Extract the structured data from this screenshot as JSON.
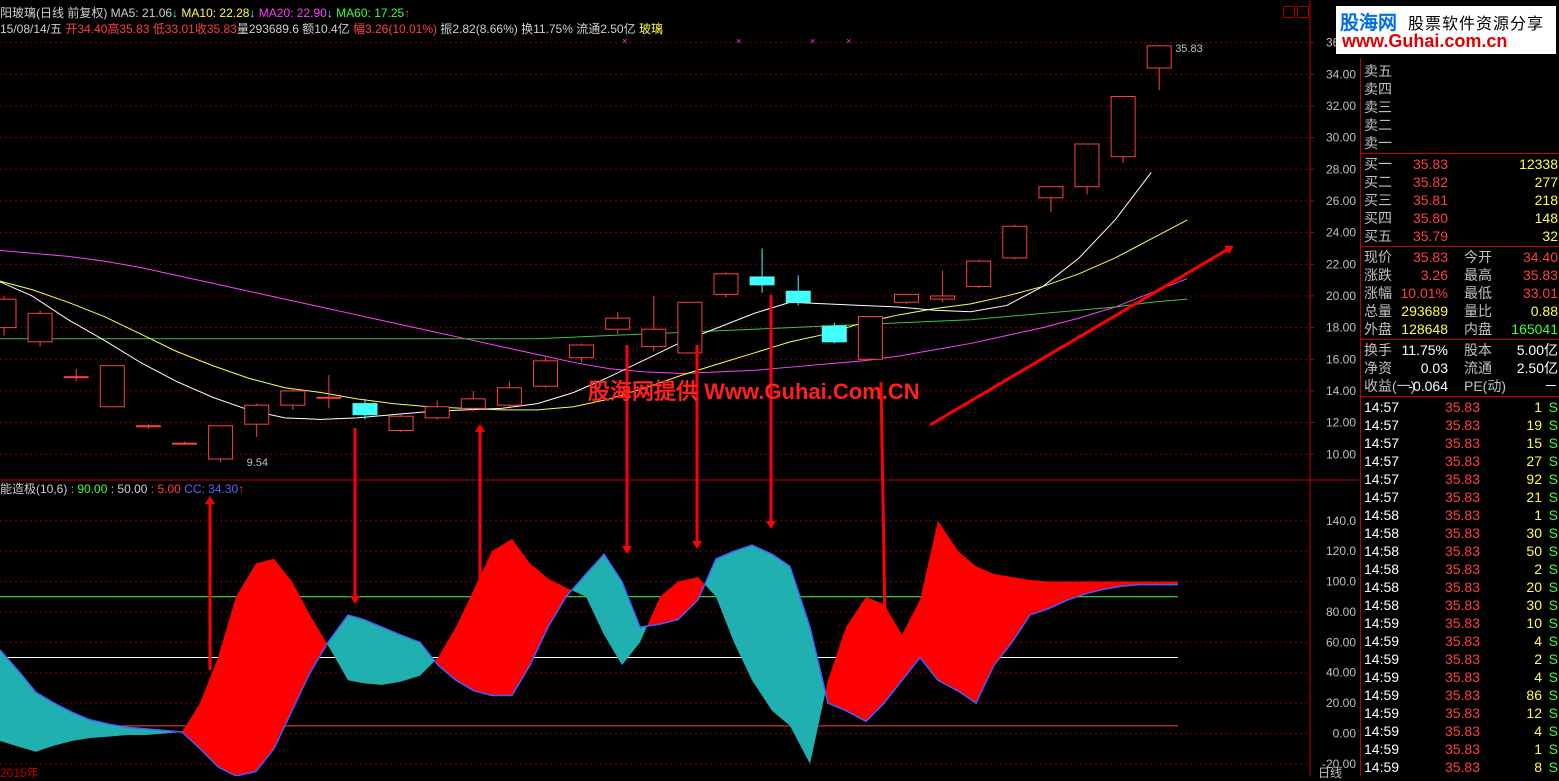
{
  "header": {
    "title": "阳玻璃(日线 前复权)",
    "ma5": "MA5: 21.06",
    "ma10": "MA10: 22.28",
    "ma20": "MA20: 22.90",
    "ma60": "MA60: 17.25",
    "date": "15/08/14/五",
    "open": "开34.40",
    "high": "高35.83",
    "low": "低33.01",
    "close": "收35.83",
    "volume": "量293689.6",
    "amount": "额10.4亿",
    "change": "幅3.26(10.01%)",
    "amplitude": "振2.82(8.66%)",
    "turnover": "换11.75%",
    "float": "流通2.50亿",
    "sector": "玻璃"
  },
  "indicator": {
    "name": "能造极(10,6)",
    "v1": ": 90.00",
    "v2": ": 50.00",
    "v3": ": 5.00",
    "cc": "CC: 34.30"
  },
  "watermark": "股海网提供 Www.Guhai.Com.CN",
  "logo": {
    "line1": "股海网",
    "line1b": "股票软件资源分享",
    "line2": "www.Guhai.com.cn"
  },
  "price_axis": [
    "36.00",
    "34.00",
    "32.00",
    "30.00",
    "28.00",
    "26.00",
    "24.00",
    "22.00",
    "20.00",
    "18.00",
    "16.00",
    "14.00",
    "12.00",
    "10.00"
  ],
  "ind_axis": [
    "140.0",
    "120.0",
    "100.0",
    "80.00",
    "60.00",
    "40.00",
    "20.00",
    "0.00",
    "-20.00"
  ],
  "annotations": {
    "high_label": "35.83",
    "low_label": "9.54"
  },
  "date_label": "2015年",
  "bottom_tag": "日线",
  "quote": {
    "sell": [
      {
        "label": "卖五"
      },
      {
        "label": "卖四"
      },
      {
        "label": "卖三"
      },
      {
        "label": "卖二"
      },
      {
        "label": "卖一"
      }
    ],
    "buy": [
      {
        "label": "买一",
        "price": "35.83",
        "vol": "12338"
      },
      {
        "label": "买二",
        "price": "35.82",
        "vol": "277"
      },
      {
        "label": "买三",
        "price": "35.81",
        "vol": "218"
      },
      {
        "label": "买四",
        "price": "35.80",
        "vol": "148"
      },
      {
        "label": "买五",
        "price": "35.79",
        "vol": "32"
      }
    ],
    "stats": [
      {
        "l1": "现价",
        "v1": "35.83",
        "l2": "今开",
        "v2": "34.40"
      },
      {
        "l1": "涨跌",
        "v1": "3.26",
        "l2": "最高",
        "v2": "35.83"
      },
      {
        "l1": "涨幅",
        "v1": "10.01%",
        "l2": "最低",
        "v2": "33.01"
      },
      {
        "l1": "总量",
        "v1": "293689",
        "l2": "量比",
        "v2": "0.88"
      },
      {
        "l1": "外盘",
        "v1": "128648",
        "l2": "内盘",
        "v2": "165041"
      }
    ],
    "stats2": [
      {
        "l1": "换手",
        "v1": "11.75%",
        "l2": "股本",
        "v2": "5.00亿"
      },
      {
        "l1": "净资",
        "v1": "0.03",
        "l2": "流通",
        "v2": "2.50亿"
      },
      {
        "l1": "收益(一)",
        "v1": "-0.064",
        "l2": "PE(动)",
        "v2": "－"
      }
    ],
    "ticks": [
      {
        "time": "14:57",
        "price": "35.83",
        "vol": "1",
        "side": "S"
      },
      {
        "time": "14:57",
        "price": "35.83",
        "vol": "19",
        "side": "S"
      },
      {
        "time": "14:57",
        "price": "35.83",
        "vol": "15",
        "side": "S"
      },
      {
        "time": "14:57",
        "price": "35.83",
        "vol": "27",
        "side": "S"
      },
      {
        "time": "14:57",
        "price": "35.83",
        "vol": "92",
        "side": "S"
      },
      {
        "time": "14:57",
        "price": "35.83",
        "vol": "21",
        "side": "S"
      },
      {
        "time": "14:58",
        "price": "35.83",
        "vol": "1",
        "side": "S"
      },
      {
        "time": "14:58",
        "price": "35.83",
        "vol": "30",
        "side": "S"
      },
      {
        "time": "14:58",
        "price": "35.83",
        "vol": "50",
        "side": "S"
      },
      {
        "time": "14:58",
        "price": "35.83",
        "vol": "2",
        "side": "S"
      },
      {
        "time": "14:58",
        "price": "35.83",
        "vol": "20",
        "side": "S"
      },
      {
        "time": "14:58",
        "price": "35.83",
        "vol": "30",
        "side": "S"
      },
      {
        "time": "14:59",
        "price": "35.83",
        "vol": "10",
        "side": "S"
      },
      {
        "time": "14:59",
        "price": "35.83",
        "vol": "4",
        "side": "S"
      },
      {
        "time": "14:59",
        "price": "35.83",
        "vol": "2",
        "side": "S"
      },
      {
        "time": "14:59",
        "price": "35.83",
        "vol": "4",
        "side": "S"
      },
      {
        "time": "14:59",
        "price": "35.83",
        "vol": "86",
        "side": "S"
      },
      {
        "time": "14:59",
        "price": "35.83",
        "vol": "12",
        "side": "S"
      },
      {
        "time": "14:59",
        "price": "35.83",
        "vol": "4",
        "side": "S"
      },
      {
        "time": "14:59",
        "price": "35.83",
        "vol": "1",
        "side": "S"
      },
      {
        "time": "14:59",
        "price": "35.83",
        "vol": "8",
        "side": "S"
      }
    ]
  },
  "colors": {
    "up": "#ff4040",
    "down": "#40ffff",
    "grid": "#800000",
    "ma5": "#ffffff",
    "ma10": "#ffff40",
    "ma20": "#ff40ff",
    "ma60": "#40c040",
    "cc": "#4060ff",
    "fill_up": "#ff0000",
    "fill_down": "#20b0b0"
  },
  "chart_data": {
    "type": "candlestick",
    "price_range": [
      8.5,
      36.8
    ],
    "candles": [
      {
        "o": 18.0,
        "c": 19.8,
        "h": 20.0,
        "l": 17.5
      },
      {
        "o": 17.1,
        "c": 18.9,
        "h": 19.1,
        "l": 16.8
      },
      {
        "o": 14.9,
        "c": 14.9,
        "h": 15.4,
        "l": 14.6
      },
      {
        "o": 13.0,
        "c": 15.6,
        "h": 15.6,
        "l": 13.0
      },
      {
        "o": 11.8,
        "c": 11.8,
        "h": 11.9,
        "l": 11.6
      },
      {
        "o": 10.7,
        "c": 10.7,
        "h": 10.8,
        "l": 10.6
      },
      {
        "o": 9.7,
        "c": 11.8,
        "h": 11.8,
        "l": 9.5
      },
      {
        "o": 11.9,
        "c": 13.1,
        "h": 13.2,
        "l": 11.1
      },
      {
        "o": 13.1,
        "c": 14.0,
        "h": 14.2,
        "l": 12.8
      },
      {
        "o": 13.6,
        "c": 13.6,
        "h": 15.0,
        "l": 12.9
      },
      {
        "o": 13.2,
        "c": 12.5,
        "h": 13.5,
        "l": 12.2
      },
      {
        "o": 11.5,
        "c": 12.4,
        "h": 12.5,
        "l": 11.4
      },
      {
        "o": 12.3,
        "c": 13.0,
        "h": 13.4,
        "l": 12.2
      },
      {
        "o": 12.9,
        "c": 13.5,
        "h": 14.0,
        "l": 12.7
      },
      {
        "o": 13.1,
        "c": 14.2,
        "h": 14.6,
        "l": 13.0
      },
      {
        "o": 14.3,
        "c": 15.9,
        "h": 16.1,
        "l": 14.2
      },
      {
        "o": 16.1,
        "c": 16.9,
        "h": 17.0,
        "l": 15.8
      },
      {
        "o": 17.9,
        "c": 18.6,
        "h": 19.0,
        "l": 17.6
      },
      {
        "o": 16.8,
        "c": 17.9,
        "h": 20.0,
        "l": 16.5
      },
      {
        "o": 16.4,
        "c": 19.6,
        "h": 19.6,
        "l": 16.4
      },
      {
        "o": 20.1,
        "c": 21.4,
        "h": 21.5,
        "l": 19.9
      },
      {
        "o": 21.2,
        "c": 20.7,
        "h": 23.0,
        "l": 20.2
      },
      {
        "o": 20.3,
        "c": 19.6,
        "h": 21.3,
        "l": 19.4
      },
      {
        "o": 18.1,
        "c": 17.1,
        "h": 18.3,
        "l": 17.0
      },
      {
        "o": 16.0,
        "c": 18.7,
        "h": 18.7,
        "l": 15.9
      },
      {
        "o": 19.6,
        "c": 20.1,
        "h": 20.1,
        "l": 19.5
      },
      {
        "o": 19.8,
        "c": 20.0,
        "h": 21.6,
        "l": 19.6
      },
      {
        "o": 20.6,
        "c": 22.2,
        "h": 22.3,
        "l": 20.5
      },
      {
        "o": 22.4,
        "c": 24.4,
        "h": 24.5,
        "l": 22.3
      },
      {
        "o": 26.2,
        "c": 26.9,
        "h": 26.9,
        "l": 25.3
      },
      {
        "o": 26.9,
        "c": 29.6,
        "h": 29.6,
        "l": 26.4
      },
      {
        "o": 28.8,
        "c": 32.6,
        "h": 32.6,
        "l": 28.4
      },
      {
        "o": 34.4,
        "c": 35.8,
        "h": 35.8,
        "l": 33.0
      }
    ],
    "ma5": [
      21.0,
      20.0,
      18.5,
      17.2,
      15.8,
      14.6,
      13.6,
      12.8,
      12.3,
      12.2,
      12.3,
      12.5,
      12.7,
      12.8,
      12.9,
      13.2,
      13.9,
      14.9,
      16.0,
      17.1,
      18.0,
      18.9,
      19.6,
      19.5,
      19.4,
      19.3,
      19.1,
      19.0,
      19.4,
      20.6,
      22.4,
      24.8,
      27.8,
      29.8
    ],
    "ma10": [
      21.0,
      20.4,
      19.6,
      18.7,
      17.6,
      16.5,
      15.6,
      14.8,
      14.2,
      13.9,
      13.5,
      13.2,
      13.0,
      12.9,
      12.8,
      12.8,
      13.0,
      13.5,
      14.2,
      15.0,
      15.7,
      16.4,
      17.1,
      17.6,
      18.3,
      18.8,
      19.2,
      19.5,
      20.0,
      20.6,
      21.4,
      22.4,
      23.6,
      24.8
    ],
    "ma20": [
      22.9,
      22.7,
      22.5,
      22.2,
      21.8,
      21.3,
      20.8,
      20.3,
      19.8,
      19.3,
      18.8,
      18.3,
      17.8,
      17.3,
      16.8,
      16.3,
      15.8,
      15.4,
      15.2,
      15.1,
      15.2,
      15.3,
      15.5,
      15.7,
      15.9,
      16.2,
      16.6,
      17.0,
      17.5,
      18.0,
      18.6,
      19.3,
      20.2,
      21.1
    ],
    "ma60": [
      17.3,
      17.3,
      17.3,
      17.3,
      17.3,
      17.3,
      17.3,
      17.3,
      17.3,
      17.3,
      17.3,
      17.3,
      17.3,
      17.3,
      17.3,
      17.3,
      17.4,
      17.5,
      17.6,
      17.7,
      17.8,
      17.9,
      18.0,
      18.1,
      18.2,
      18.3,
      18.4,
      18.5,
      18.7,
      18.9,
      19.1,
      19.3,
      19.6,
      19.8
    ],
    "ind_range": [
      -28,
      155
    ],
    "ind_ref_lines": [
      90,
      50,
      5
    ],
    "ind_x": [
      0,
      20,
      36,
      54,
      72,
      90,
      110,
      128,
      146,
      164,
      182,
      200,
      218,
      236,
      256,
      274,
      292,
      310,
      328,
      348,
      364,
      382,
      400,
      420,
      438,
      456,
      474,
      492,
      512,
      530,
      548,
      566,
      586,
      604,
      622,
      640,
      660,
      678,
      698,
      716,
      734,
      752,
      772,
      790,
      810,
      828,
      846,
      866,
      884,
      902,
      920,
      938,
      958,
      976,
      994,
      1012,
      1030,
      1048,
      1068,
      1086,
      1104,
      1122,
      1140,
      1158,
      1178
    ],
    "ind_cc": [
      55,
      40,
      27,
      20,
      14,
      9,
      6,
      4,
      3,
      2,
      1,
      -10,
      -22,
      -28,
      -25,
      -10,
      15,
      40,
      60,
      78,
      75,
      70,
      65,
      60,
      45,
      35,
      28,
      25,
      25,
      45,
      70,
      90,
      105,
      118,
      100,
      70,
      72,
      75,
      88,
      115,
      120,
      124,
      118,
      110,
      70,
      20,
      15,
      8,
      20,
      35,
      50,
      35,
      28,
      20,
      45,
      60,
      78,
      82,
      88,
      92,
      95,
      97,
      98,
      98,
      98
    ],
    "ind_a": [
      -5,
      -9,
      -12,
      -8,
      -5,
      -3,
      -2,
      -1,
      -1,
      0,
      1,
      20,
      50,
      90,
      112,
      115,
      100,
      78,
      58,
      35,
      33,
      32,
      34,
      38,
      50,
      70,
      95,
      120,
      128,
      112,
      102,
      96,
      90,
      65,
      45,
      60,
      90,
      100,
      103,
      90,
      60,
      35,
      15,
      5,
      -20,
      35,
      70,
      90,
      85,
      65,
      88,
      140,
      120,
      110,
      105,
      103,
      101,
      100,
      100,
      100,
      100,
      100,
      100,
      100,
      100
    ]
  }
}
